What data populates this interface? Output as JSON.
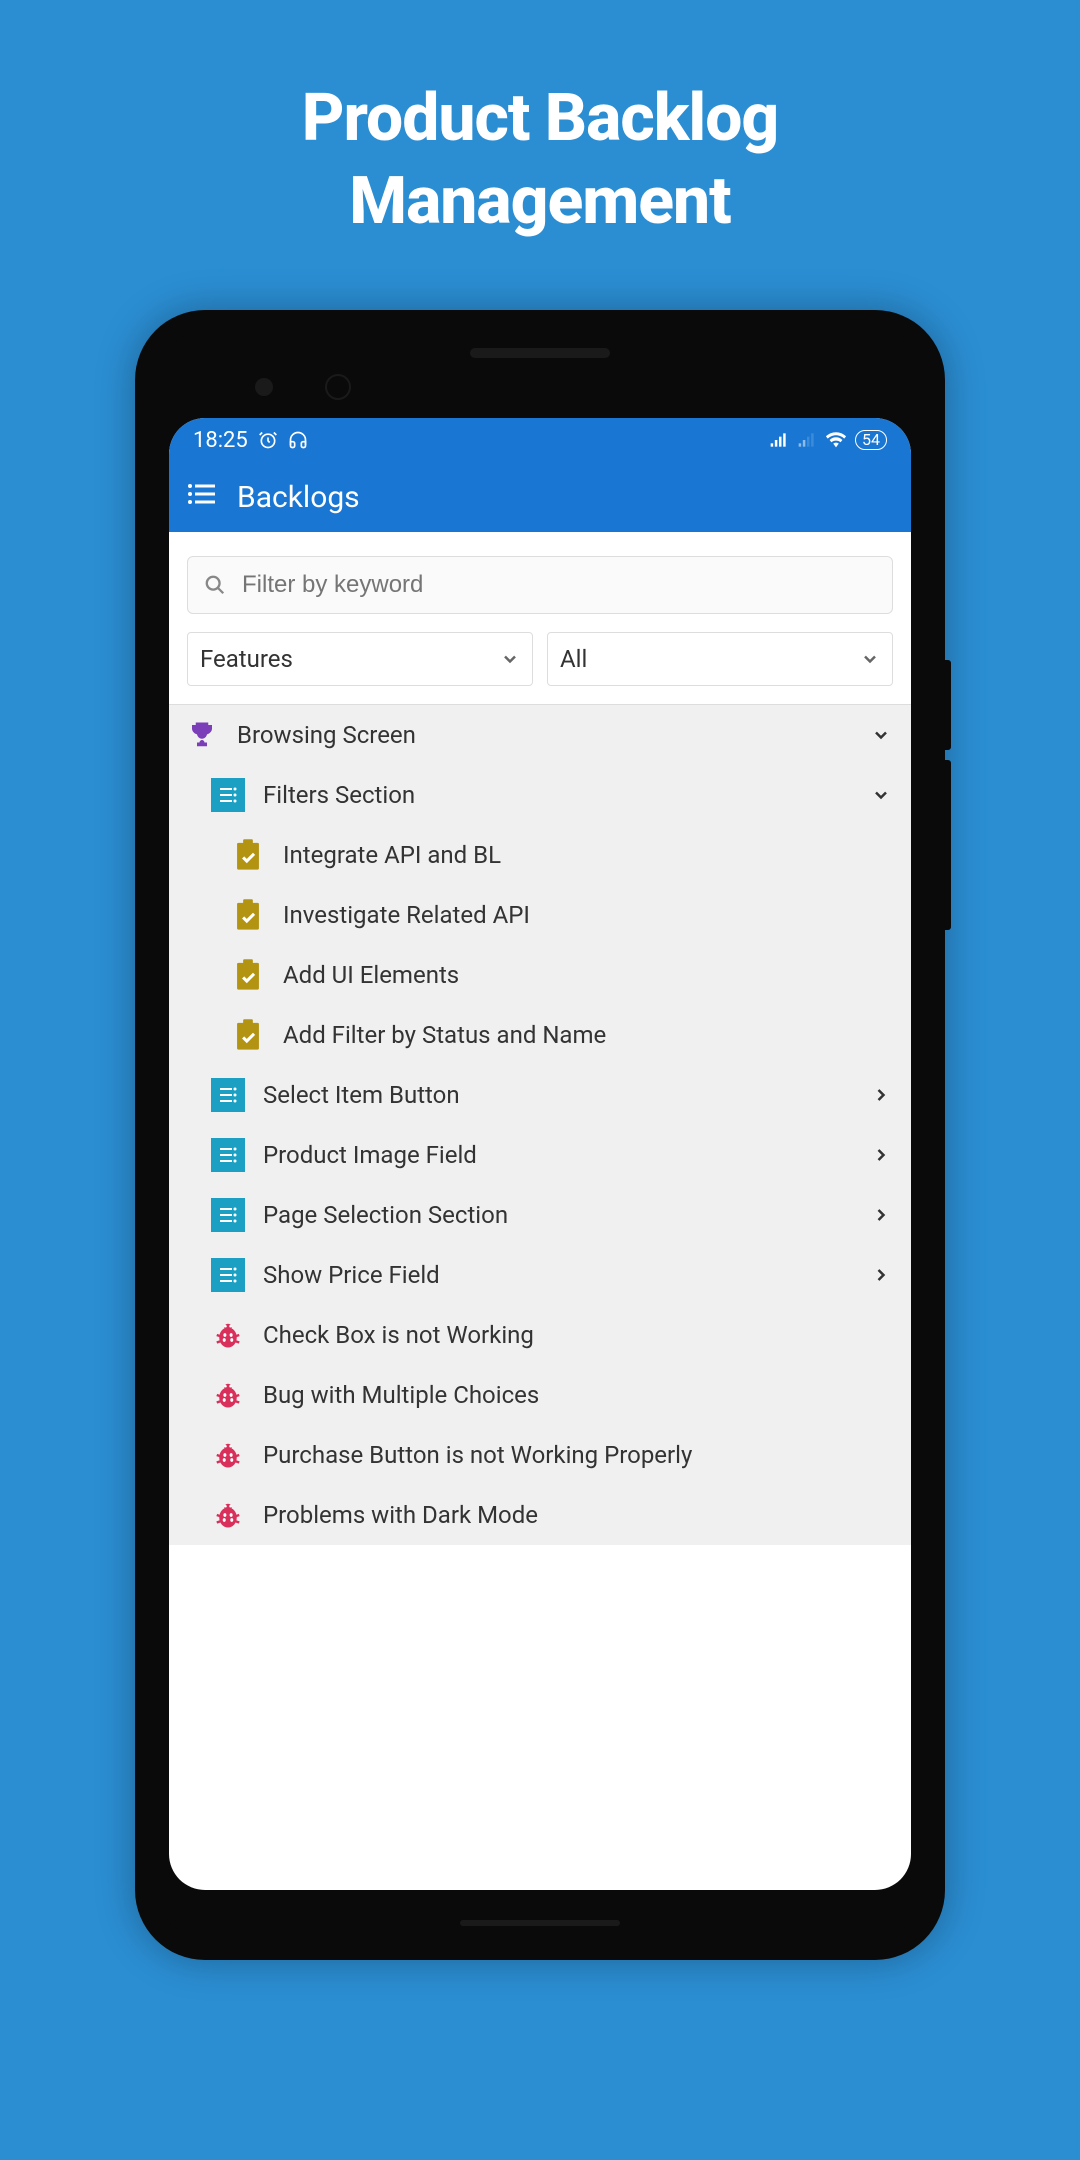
{
  "promo": {
    "title_line1": "Product Backlog",
    "title_line2": "Management"
  },
  "status_bar": {
    "time": "18:25",
    "battery": "54"
  },
  "app_bar": {
    "title": "Backlogs"
  },
  "search": {
    "placeholder": "Filter by keyword"
  },
  "dropdowns": {
    "type": "Features",
    "status": "All"
  },
  "tree": {
    "epic": "Browsing Screen",
    "feature_filters": "Filters Section",
    "tasks": [
      "Integrate API and BL",
      "Investigate Related API",
      "Add UI Elements",
      "Add Filter by Status and Name"
    ],
    "features": [
      "Select Item Button",
      "Product Image Field",
      "Page Selection Section",
      "Show Price Field"
    ],
    "bugs": [
      "Check Box is not Working",
      "Bug with Multiple Choices",
      "Purchase Button is not Working Properly",
      "Problems with Dark Mode"
    ]
  }
}
